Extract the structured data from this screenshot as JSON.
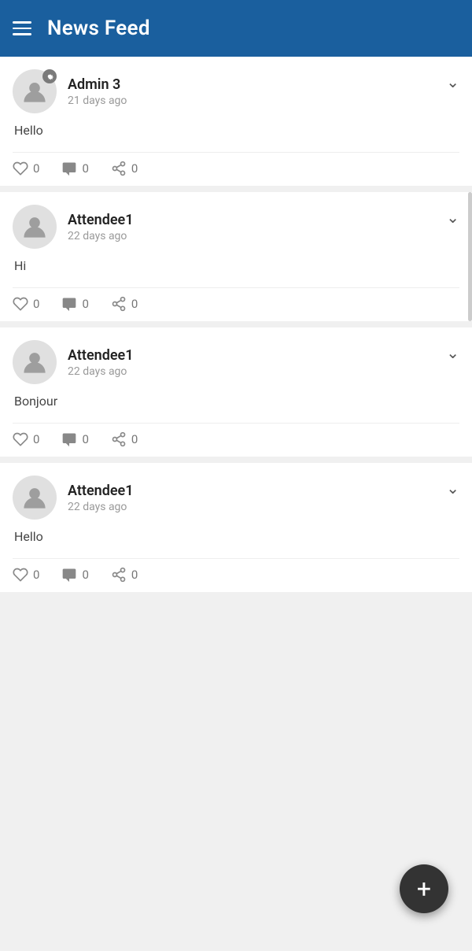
{
  "header": {
    "title": "News Feed",
    "menu_label": "menu"
  },
  "posts": [
    {
      "id": "post-1",
      "author": "Admin 3",
      "time_ago": "21 days ago",
      "avatar_type": "admin",
      "content": "Hello",
      "likes": 0,
      "comments": 0,
      "shares": 0
    },
    {
      "id": "post-2",
      "author": "Attendee1",
      "time_ago": "22 days ago",
      "avatar_type": "attendee",
      "content": "Hi",
      "likes": 0,
      "comments": 0,
      "shares": 0
    },
    {
      "id": "post-3",
      "author": "Attendee1",
      "time_ago": "22 days ago",
      "avatar_type": "attendee",
      "content": "Bonjour",
      "likes": 0,
      "comments": 0,
      "shares": 0
    },
    {
      "id": "post-4",
      "author": "Attendee1",
      "time_ago": "22 days ago",
      "avatar_type": "attendee",
      "content": "Hello",
      "likes": 0,
      "comments": 0,
      "shares": 0
    }
  ],
  "fab": {
    "label": "+"
  }
}
